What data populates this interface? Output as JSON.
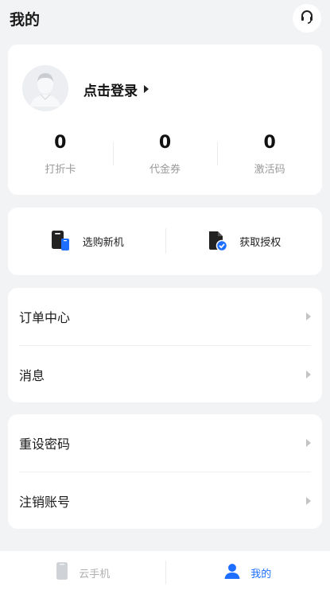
{
  "header": {
    "title": "我的",
    "support_icon": "headset-icon"
  },
  "profile": {
    "avatar_icon": "default-avatar-icon",
    "login_label": "点击登录",
    "stats": [
      {
        "value": "0",
        "label": "打折卡"
      },
      {
        "value": "0",
        "label": "代金券"
      },
      {
        "value": "0",
        "label": "激活码"
      }
    ]
  },
  "quick_actions": [
    {
      "label": "选购新机",
      "icon": "phone-buy-icon"
    },
    {
      "label": "获取授权",
      "icon": "authorize-document-icon"
    }
  ],
  "menu_group_1": [
    {
      "label": "订单中心"
    },
    {
      "label": "消息"
    }
  ],
  "menu_group_2": [
    {
      "label": "重设密码"
    },
    {
      "label": "注销账号"
    }
  ],
  "tabbar": {
    "tabs": [
      {
        "label": "云手机",
        "icon": "cloud-phone-icon",
        "active": false
      },
      {
        "label": "我的",
        "icon": "user-icon",
        "active": true
      }
    ]
  },
  "colors": {
    "accent": "#1e6fff",
    "background": "#f2f3f5",
    "inactive": "#b0b0b0"
  }
}
